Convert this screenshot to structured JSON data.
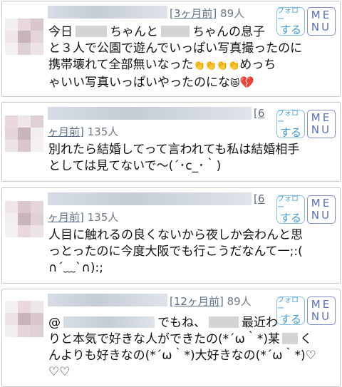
{
  "posts": [
    {
      "ago": "[3ヶ月前]",
      "count": "89人",
      "follow_top": "フォロー",
      "follow_bottom": "する",
      "menu_top": "ME",
      "menu_bottom": "NU",
      "line1_a": "今日",
      "line1_b": "ちゃんと",
      "line1_c": "ちゃんの息子",
      "line2": "と３人で公園で遊んでいっぱい写真撮ったのに",
      "line3_a": "携帯壊れて全部無いなった",
      "line3_emoji": "👏👏👏👏",
      "line3_b": "めっち",
      "line4": "ゃいい写真いっぱいやったのにな",
      "line4_emoji": "😿",
      "line4_heart": "💔"
    },
    {
      "ago_a": "[6",
      "ago_b": "ヶ月前]",
      "count": "135人",
      "follow_top": "フォロー",
      "follow_bottom": "する",
      "menu_top": "ME",
      "menu_bottom": "NU",
      "line1": "別れたら結婚してって言われても私は結婚相手",
      "line2": "としては見てないで〜(´･c_･｀)"
    },
    {
      "ago_a": "[6",
      "ago_b": "ヶ月前]",
      "count": "135人",
      "follow_top": "フォロー",
      "follow_bottom": "する",
      "menu_top": "ME",
      "menu_bottom": "NU",
      "line1": "人目に触れるの良くないから夜しか会わんと思",
      "line2": "っとったのに今度大阪でも行こうだなんて一;:(",
      "line3": "∩´﹏`∩):;"
    },
    {
      "ago": "[12ヶ月前]",
      "count": "89人",
      "follow_top": "フォロー",
      "follow_bottom": "する",
      "menu_top": "ME",
      "menu_bottom": "NU",
      "line1_a": "@",
      "line1_b": "でもね、",
      "line1_c": "最近わ",
      "line2_a": "りと本気で好きな人ができたの(*´ω｀*)某",
      "line2_b": "く",
      "line3": "んよりも好きなの(*´ω｀*)大好きなの(*´ω｀*)♡",
      "line4": "♡♡"
    }
  ],
  "colors": {
    "follow": "#3f9ad6",
    "menu": "#5b6fc2",
    "border": "#c9c9c9",
    "link": "#5a6f86"
  }
}
